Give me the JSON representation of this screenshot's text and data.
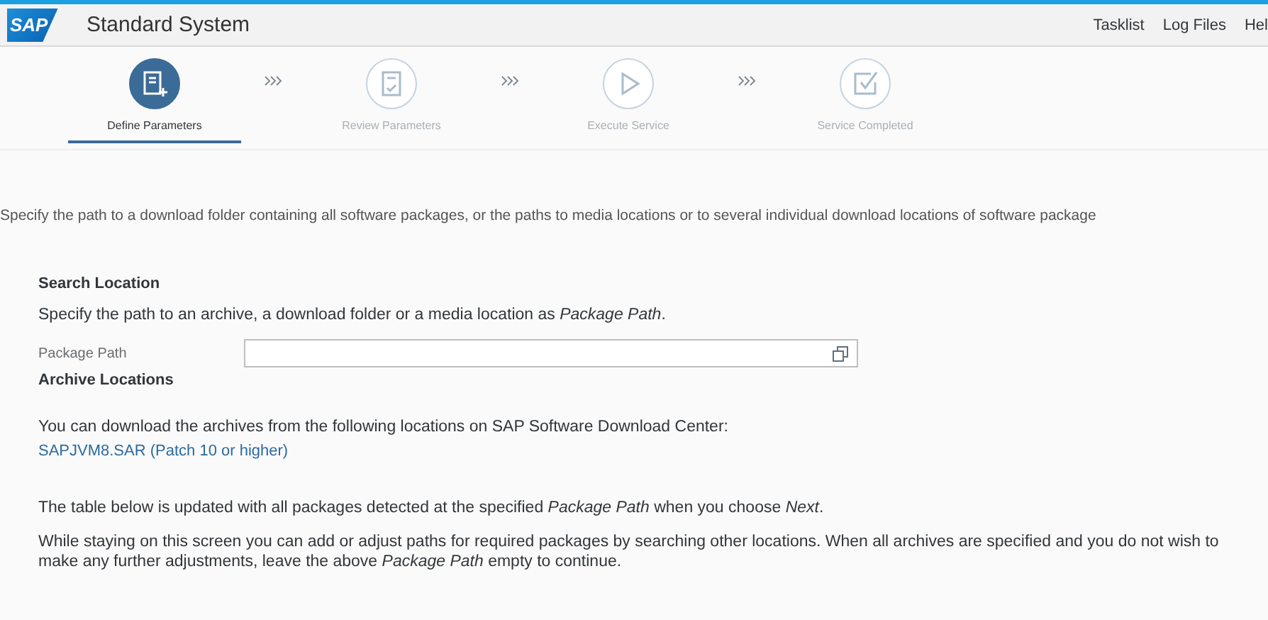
{
  "header": {
    "logo": "SAP",
    "title": "Standard System",
    "links": [
      "Tasklist",
      "Log Files",
      "Hel"
    ]
  },
  "steps": [
    {
      "label": "Define Parameters",
      "selected": true
    },
    {
      "label": "Review Parameters",
      "selected": false
    },
    {
      "label": "Execute Service",
      "selected": false
    },
    {
      "label": "Service Completed",
      "selected": false
    }
  ],
  "intro": "Specify the path to a download folder containing all software packages, or the paths to media locations or to several individual download locations of software package",
  "search_location": {
    "title": "Search Location",
    "description": "Specify the path to an archive, a download folder or a media location as *Package Path*.",
    "field_label": "Package Path"
  },
  "archive_locations": {
    "title": "Archive Locations",
    "description": "You can download the archives from the following locations on SAP Software Download Center:",
    "link": "SAPJVM8.SAR (Patch 10 or higher)"
  },
  "notes": [
    "The table below is updated with all packages detected at the specified *Package Path* when you choose *Next*.",
    "While staying on this screen you can add or adjust paths for required packages by searching other locations. When all archives are specified and you do not wish to make any further adjustments, leave the above *Package Path* empty to continue."
  ]
}
